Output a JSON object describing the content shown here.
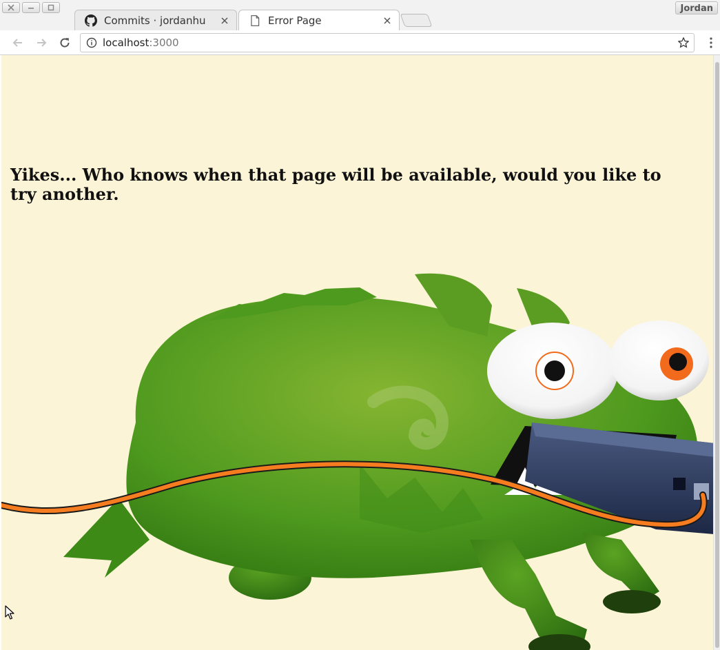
{
  "window": {
    "profile_name": "Jordan"
  },
  "tabs": [
    {
      "title": "Commits · jordanhu",
      "icon": "github-icon",
      "active": false
    },
    {
      "title": "Error Page",
      "icon": "page-icon",
      "active": true
    }
  ],
  "toolbar": {
    "url_host": "localhost",
    "url_port": ":3000"
  },
  "page": {
    "heading": "Yikes... Who knows when that page will be available, would you like to try another.",
    "background": "#fcf4d6",
    "illustration": "green-monster-chewing-cable-illustration"
  },
  "colors": {
    "monster_green": "#4e9a1e",
    "eye_orange": "#f26a1b",
    "cable_orange": "#f57c1f",
    "plug_navy": "#2c3a5c"
  }
}
